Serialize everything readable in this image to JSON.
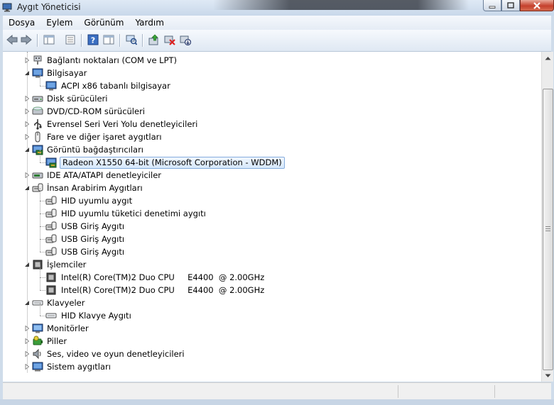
{
  "window": {
    "title": "Aygıt Yöneticisi"
  },
  "menu": [
    "Dosya",
    "Eylem",
    "Görünüm",
    "Yardım"
  ],
  "toolbar": [
    {
      "icon": "back-arrow-icon"
    },
    {
      "icon": "forward-arrow-icon"
    },
    {
      "icon": "show-hide-console-tree-icon"
    },
    {
      "icon": "properties-icon"
    },
    {
      "icon": "help-icon"
    },
    {
      "icon": "action-pane-icon"
    },
    {
      "icon": "scan-hardware-changes-icon"
    },
    {
      "icon": "update-driver-icon"
    },
    {
      "icon": "uninstall-icon"
    },
    {
      "icon": "disable-device-icon"
    }
  ],
  "tree": [
    {
      "level": 0,
      "expander": "collapsed",
      "icon": "port-icon",
      "label": "Bağlantı noktaları (COM ve LPT)"
    },
    {
      "level": 0,
      "expander": "expanded",
      "icon": "computer-icon",
      "label": "Bilgisayar"
    },
    {
      "level": 1,
      "expander": "none",
      "icon": "computer-icon",
      "label": "ACPI x86 tabanlı bilgisayar"
    },
    {
      "level": 0,
      "expander": "collapsed",
      "icon": "disk-drive-icon",
      "label": "Disk sürücüleri"
    },
    {
      "level": 0,
      "expander": "collapsed",
      "icon": "dvd-drive-icon",
      "label": "DVD/CD-ROM sürücüleri"
    },
    {
      "level": 0,
      "expander": "collapsed",
      "icon": "usb-icon",
      "label": "Evrensel Seri Veri Yolu denetleyicileri"
    },
    {
      "level": 0,
      "expander": "collapsed",
      "icon": "mouse-icon",
      "label": "Fare ve diğer işaret aygıtları"
    },
    {
      "level": 0,
      "expander": "expanded",
      "icon": "display-adapter-icon",
      "label": "Görüntü bağdaştırıcıları"
    },
    {
      "level": 1,
      "expander": "none",
      "icon": "display-adapter-icon",
      "label": "Radeon X1550 64-bit (Microsoft Corporation - WDDM)",
      "selected": true
    },
    {
      "level": 0,
      "expander": "collapsed",
      "icon": "ide-controller-icon",
      "label": "IDE ATA/ATAPI denetleyiciler"
    },
    {
      "level": 0,
      "expander": "expanded",
      "icon": "hid-icon",
      "label": "İnsan Arabirim Aygıtları"
    },
    {
      "level": 1,
      "expander": "none",
      "icon": "hid-icon",
      "label": "HID uyumlu aygıt"
    },
    {
      "level": 1,
      "expander": "none",
      "icon": "hid-icon",
      "label": "HID uyumlu tüketici denetimi aygıtı"
    },
    {
      "level": 1,
      "expander": "none",
      "icon": "hid-icon",
      "label": "USB Giriş Aygıtı"
    },
    {
      "level": 1,
      "expander": "none",
      "icon": "hid-icon",
      "label": "USB Giriş Aygıtı"
    },
    {
      "level": 1,
      "expander": "none",
      "icon": "hid-icon",
      "label": "USB Giriş Aygıtı"
    },
    {
      "level": 0,
      "expander": "expanded",
      "icon": "processor-icon",
      "label": "İşlemciler"
    },
    {
      "level": 1,
      "expander": "none",
      "icon": "processor-icon",
      "label": "Intel(R) Core(TM)2 Duo CPU     E4400  @ 2.00GHz"
    },
    {
      "level": 1,
      "expander": "none",
      "icon": "processor-icon",
      "label": "Intel(R) Core(TM)2 Duo CPU     E4400  @ 2.00GHz"
    },
    {
      "level": 0,
      "expander": "expanded",
      "icon": "keyboard-icon",
      "label": "Klavyeler"
    },
    {
      "level": 1,
      "expander": "none",
      "icon": "keyboard-icon",
      "label": "HID Klavye Aygıtı"
    },
    {
      "level": 0,
      "expander": "collapsed",
      "icon": "monitor-icon",
      "label": "Monitörler"
    },
    {
      "level": 0,
      "expander": "collapsed",
      "icon": "battery-icon",
      "label": "Piller"
    },
    {
      "level": 0,
      "expander": "collapsed",
      "icon": "speaker-icon",
      "label": "Ses, video ve oyun denetleyicileri"
    },
    {
      "level": 0,
      "expander": "collapsed",
      "icon": "system-devices-icon",
      "label": "Sistem aygıtları"
    }
  ],
  "colors": {
    "selection_border": "#84acdd",
    "selection_fill": "#d6e8fb",
    "frame": "#cfdcea"
  }
}
